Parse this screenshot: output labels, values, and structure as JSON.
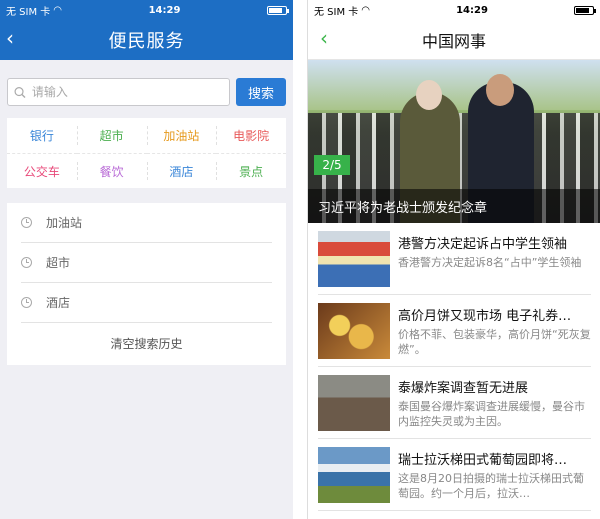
{
  "left": {
    "status": {
      "carrier": "无 SIM 卡",
      "time": "14:29"
    },
    "nav": {
      "back": "‹",
      "title": "便民服务"
    },
    "search": {
      "placeholder": "请输入",
      "button": "搜索"
    },
    "categories": [
      {
        "label": "银行",
        "color": "#3a86d8"
      },
      {
        "label": "超市",
        "color": "#4caf50"
      },
      {
        "label": "加油站",
        "color": "#e69a1e"
      },
      {
        "label": "电影院",
        "color": "#e85a5a"
      },
      {
        "label": "公交车",
        "color": "#e84a7a"
      },
      {
        "label": "餐饮",
        "color": "#b86ad6"
      },
      {
        "label": "酒店",
        "color": "#3a86d8"
      },
      {
        "label": "景点",
        "color": "#4caf50"
      }
    ],
    "history": [
      "加油站",
      "超市",
      "酒店"
    ],
    "clear_history": "清空搜索历史"
  },
  "right": {
    "status": {
      "carrier": "无 SIM 卡",
      "time": "14:29"
    },
    "nav": {
      "back": "‹",
      "title": "中国网事"
    },
    "hero": {
      "counter": "2/5",
      "caption": "习近平将为老战士颁发纪念章"
    },
    "news": [
      {
        "title": "港警方决定起诉占中学生领袖",
        "desc": "香港警方决定起诉8名“占中”学生领袖"
      },
      {
        "title": "高价月饼又现市场 电子礼券…",
        "desc": "价格不菲、包装豪华，高价月饼“死灰复燃”。"
      },
      {
        "title": "泰爆炸案调查暂无进展",
        "desc": "泰国曼谷爆炸案调查进展缓慢，曼谷市内监控失灵或为主因。"
      },
      {
        "title": "瑞士拉沃梯田式葡萄园即将…",
        "desc": "这是8月20日拍摄的瑞士拉沃梯田式葡萄园。约一个月后，拉沃…"
      }
    ]
  }
}
